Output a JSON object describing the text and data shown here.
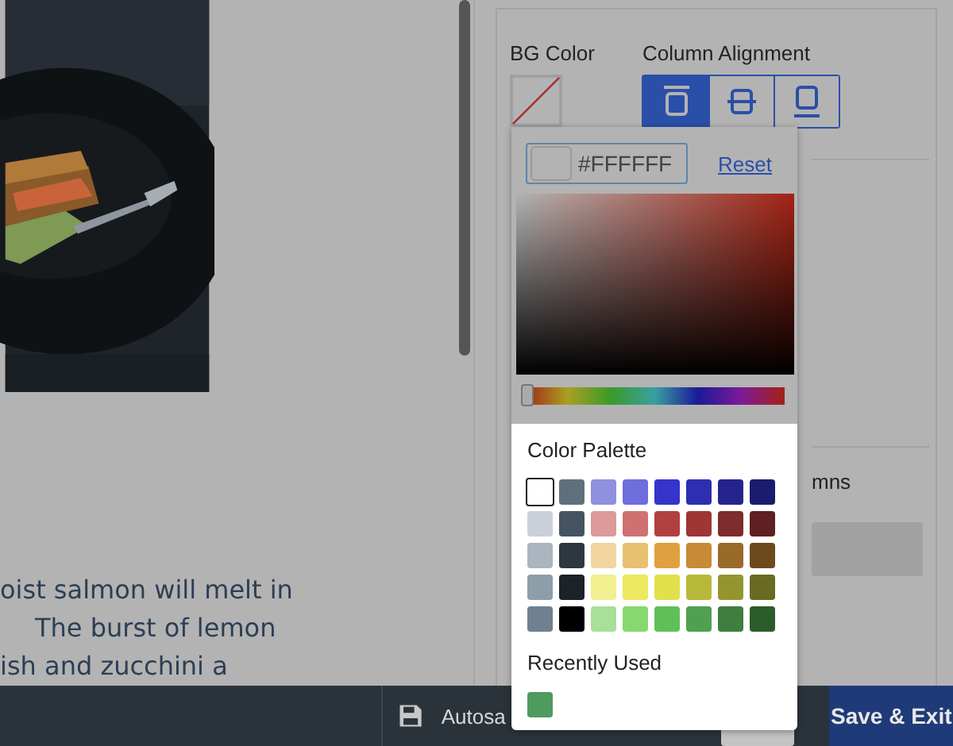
{
  "article": {
    "lines": [
      {
        "text": "oist salmon will melt in",
        "indent": false
      },
      {
        "text": "The burst of lemon",
        "indent": true
      },
      {
        "text": "ish and zucchini a",
        "indent": false
      }
    ]
  },
  "settings": {
    "bg_color_label": "BG Color",
    "column_alignment_label": "Column Alignment",
    "alignment_options": [
      {
        "kind": "top",
        "selected": true
      },
      {
        "kind": "middle",
        "selected": false
      },
      {
        "kind": "bottom",
        "selected": false
      }
    ],
    "columns_label": "mns"
  },
  "color_picker": {
    "hex_value": "#FFFFFF",
    "reset_label": "Reset",
    "hue": {
      "level": 0
    },
    "palette_title": "Color Palette",
    "palette": [
      {
        "color": "#ffffff",
        "selected": true
      },
      {
        "color": "#5f6f7e",
        "selected": false
      },
      {
        "color": "#8f90e0",
        "selected": false
      },
      {
        "color": "#6e6edc",
        "selected": false
      },
      {
        "color": "#3535cc",
        "selected": false
      },
      {
        "color": "#2e2eb0",
        "selected": false
      },
      {
        "color": "#25248f",
        "selected": false
      },
      {
        "color": "#1c1c6e",
        "selected": false
      },
      {
        "color": "#c9d0d8",
        "selected": false
      },
      {
        "color": "#455460",
        "selected": false
      },
      {
        "color": "#dc9a9a",
        "selected": false
      },
      {
        "color": "#cf7171",
        "selected": false
      },
      {
        "color": "#b34040",
        "selected": false
      },
      {
        "color": "#a03535",
        "selected": false
      },
      {
        "color": "#7e2c2c",
        "selected": false
      },
      {
        "color": "#5e2020",
        "selected": false
      },
      {
        "color": "#aab5c0",
        "selected": false
      },
      {
        "color": "#2c3740",
        "selected": false
      },
      {
        "color": "#f1d5a0",
        "selected": false
      },
      {
        "color": "#e8c070",
        "selected": false
      },
      {
        "color": "#e0a040",
        "selected": false
      },
      {
        "color": "#c88a35",
        "selected": false
      },
      {
        "color": "#9a6a28",
        "selected": false
      },
      {
        "color": "#6c4a1c",
        "selected": false
      },
      {
        "color": "#8e9ea9",
        "selected": false
      },
      {
        "color": "#1b2228",
        "selected": false
      },
      {
        "color": "#f1ef90",
        "selected": false
      },
      {
        "color": "#ece860",
        "selected": false
      },
      {
        "color": "#e2e04a",
        "selected": false
      },
      {
        "color": "#b8b83a",
        "selected": false
      },
      {
        "color": "#959530",
        "selected": false
      },
      {
        "color": "#6a6a22",
        "selected": false
      },
      {
        "color": "#6f8190",
        "selected": false
      },
      {
        "color": "#000000",
        "selected": false
      },
      {
        "color": "#a8e098",
        "selected": false
      },
      {
        "color": "#88d870",
        "selected": false
      },
      {
        "color": "#60c058",
        "selected": false
      },
      {
        "color": "#50a050",
        "selected": false
      },
      {
        "color": "#3e7e3e",
        "selected": false
      },
      {
        "color": "#2c5c2a",
        "selected": false
      }
    ],
    "recent_title": "Recently Used",
    "recent": [
      {
        "color": "#4f9a5f"
      }
    ]
  },
  "footer": {
    "autosave_text": "Autosa",
    "save_exit_label": "Save & Exit"
  }
}
